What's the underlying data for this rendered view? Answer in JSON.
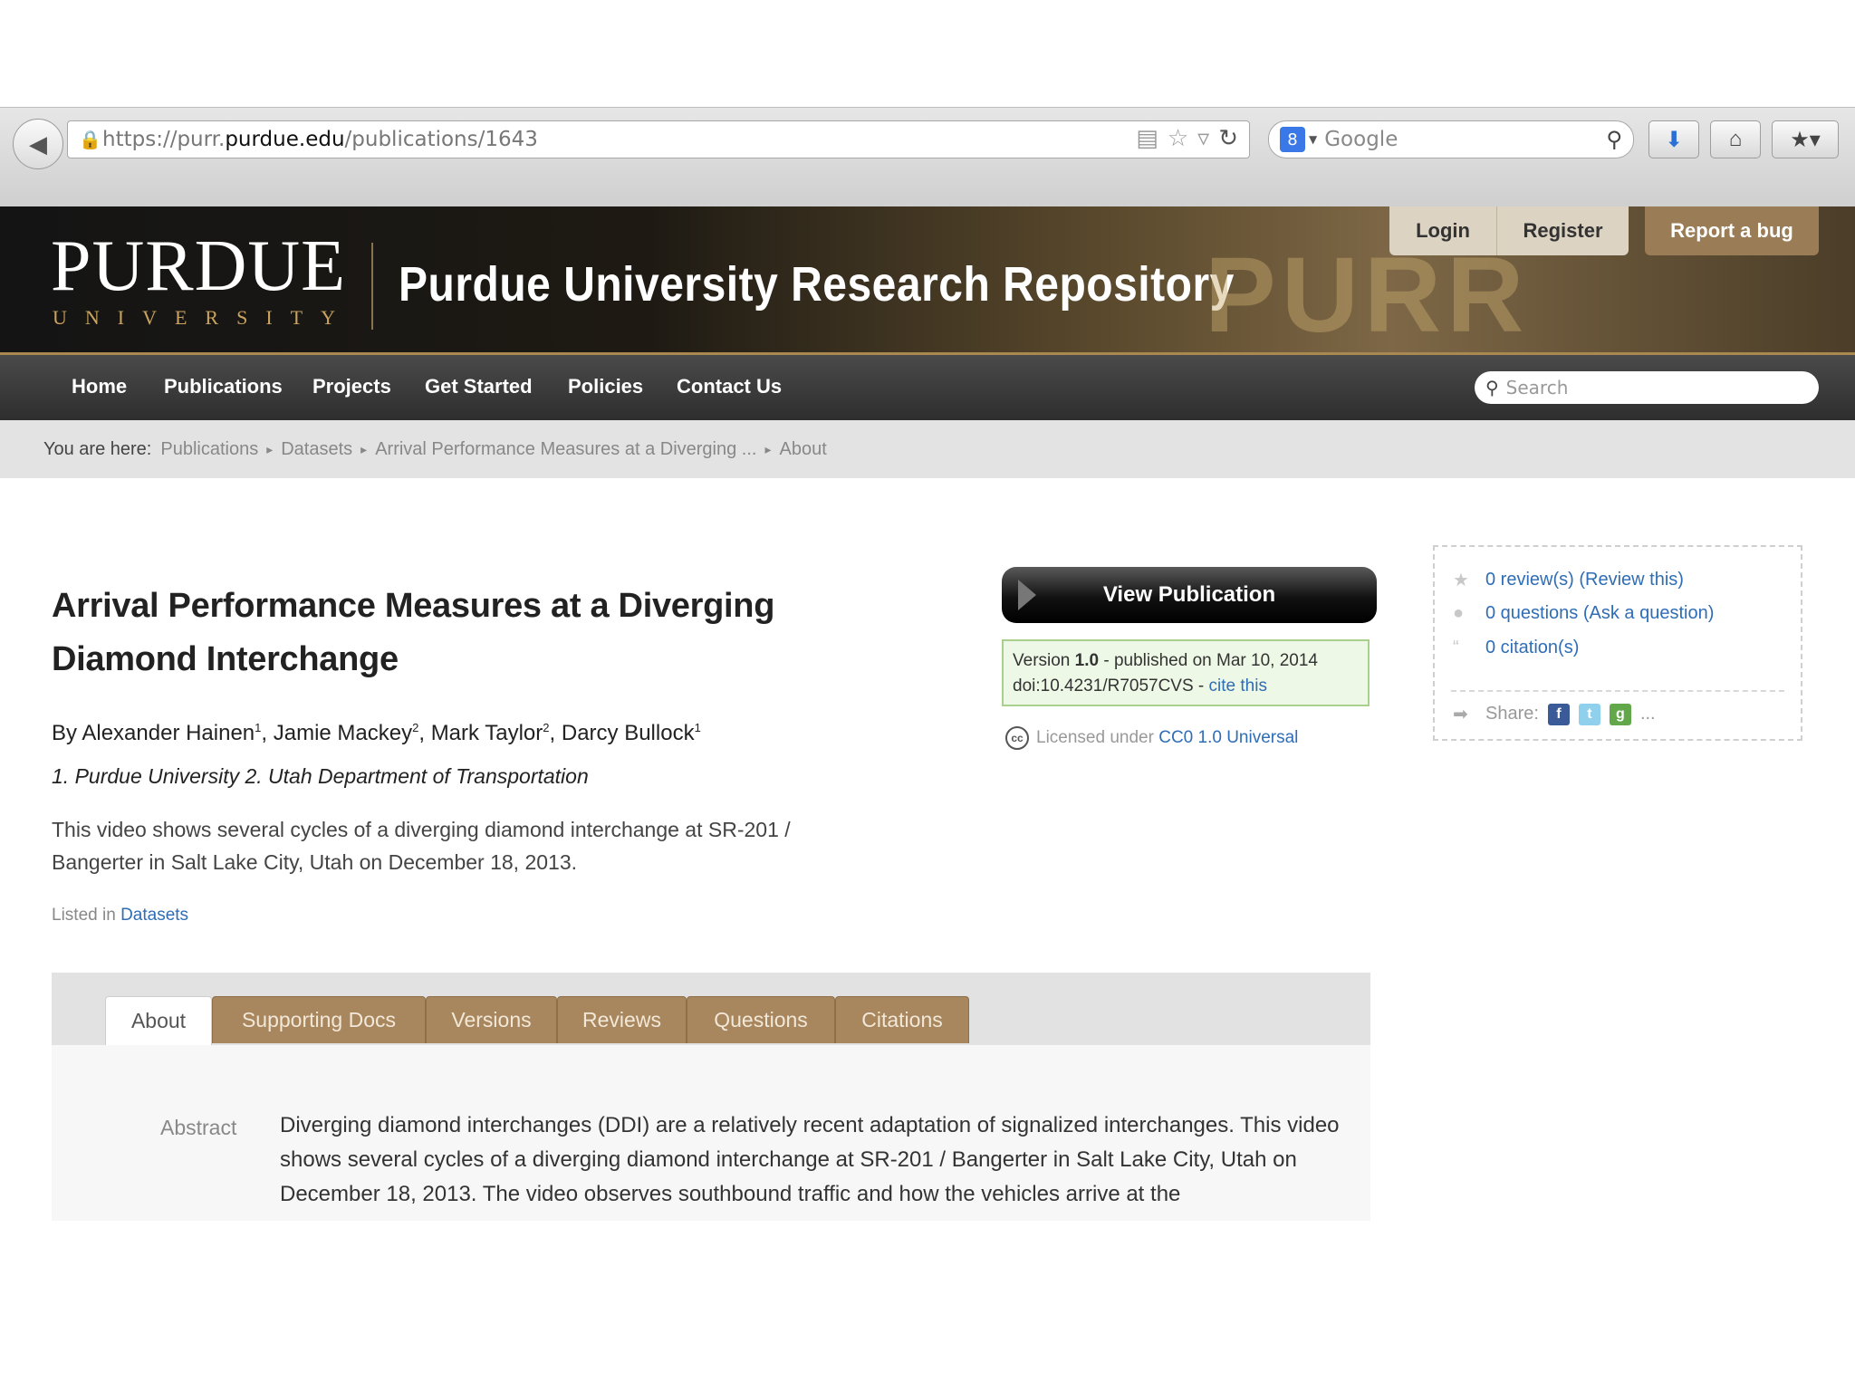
{
  "browser": {
    "url_prefix": "https://purr.",
    "url_host": "purdue.edu",
    "url_path": "/publications/1643",
    "search_engine": "Google"
  },
  "header": {
    "logo_word": "PURDUE",
    "logo_sub": "UNIVERSITY",
    "site_title": "Purdue University Research Repository",
    "watermark": "PURR",
    "login": "Login",
    "register": "Register",
    "report_bug": "Report a bug"
  },
  "nav": {
    "items": [
      "Home",
      "Publications",
      "Projects",
      "Get Started",
      "Policies",
      "Contact Us"
    ],
    "search_placeholder": "Search"
  },
  "breadcrumb": {
    "label": "You are here:",
    "items": [
      "Publications",
      "Datasets",
      "Arrival Performance Measures at a Diverging ...",
      "About"
    ]
  },
  "publication": {
    "title": "Arrival Performance Measures at a Diverging Diamond Interchange",
    "authors": [
      {
        "name": "Alexander Hainen",
        "aff": "1"
      },
      {
        "name": "Jamie Mackey",
        "aff": "2"
      },
      {
        "name": "Mark Taylor",
        "aff": "2"
      },
      {
        "name": "Darcy Bullock",
        "aff": "1"
      }
    ],
    "by": "By",
    "affiliations": "1. Purdue University 2. Utah Department of Transportation",
    "summary": "This video shows several cycles of a diverging diamond interchange at SR-201 / Bangerter in Salt Lake City, Utah on December 18, 2013.",
    "listed_in_label": "Listed in",
    "listed_in_link": "Datasets"
  },
  "actions": {
    "view_publication": "View Publication",
    "version_prefix": "Version",
    "version_number": "1.0",
    "published": "- published on Mar 10, 2014",
    "doi": "doi:10.4231/R7057CVS -",
    "cite_this": "cite this",
    "license_prefix": "Licensed under",
    "license_link": "CC0 1.0 Universal",
    "cc_icon_text": "cc"
  },
  "sidebar": {
    "reviews": "0 review(s) (Review this)",
    "questions": "0 questions (Ask a question)",
    "citations": "0 citation(s)",
    "share_label": "Share:",
    "share_more": "..."
  },
  "tabs": [
    "About",
    "Supporting Docs",
    "Versions",
    "Reviews",
    "Questions",
    "Citations"
  ],
  "abstract": {
    "label": "Abstract",
    "text": "Diverging diamond interchanges (DDI) are a relatively recent adaptation of signalized interchanges. This video shows several cycles of a diverging diamond interchange at SR-201 / Bangerter in Salt Lake City, Utah on December 18, 2013. The video observes southbound traffic and how the vehicles arrive at the"
  },
  "colors": {
    "accent_link": "#2f6db5",
    "tab_brown": "#a8865e",
    "header_gold": "#c9a35f"
  }
}
